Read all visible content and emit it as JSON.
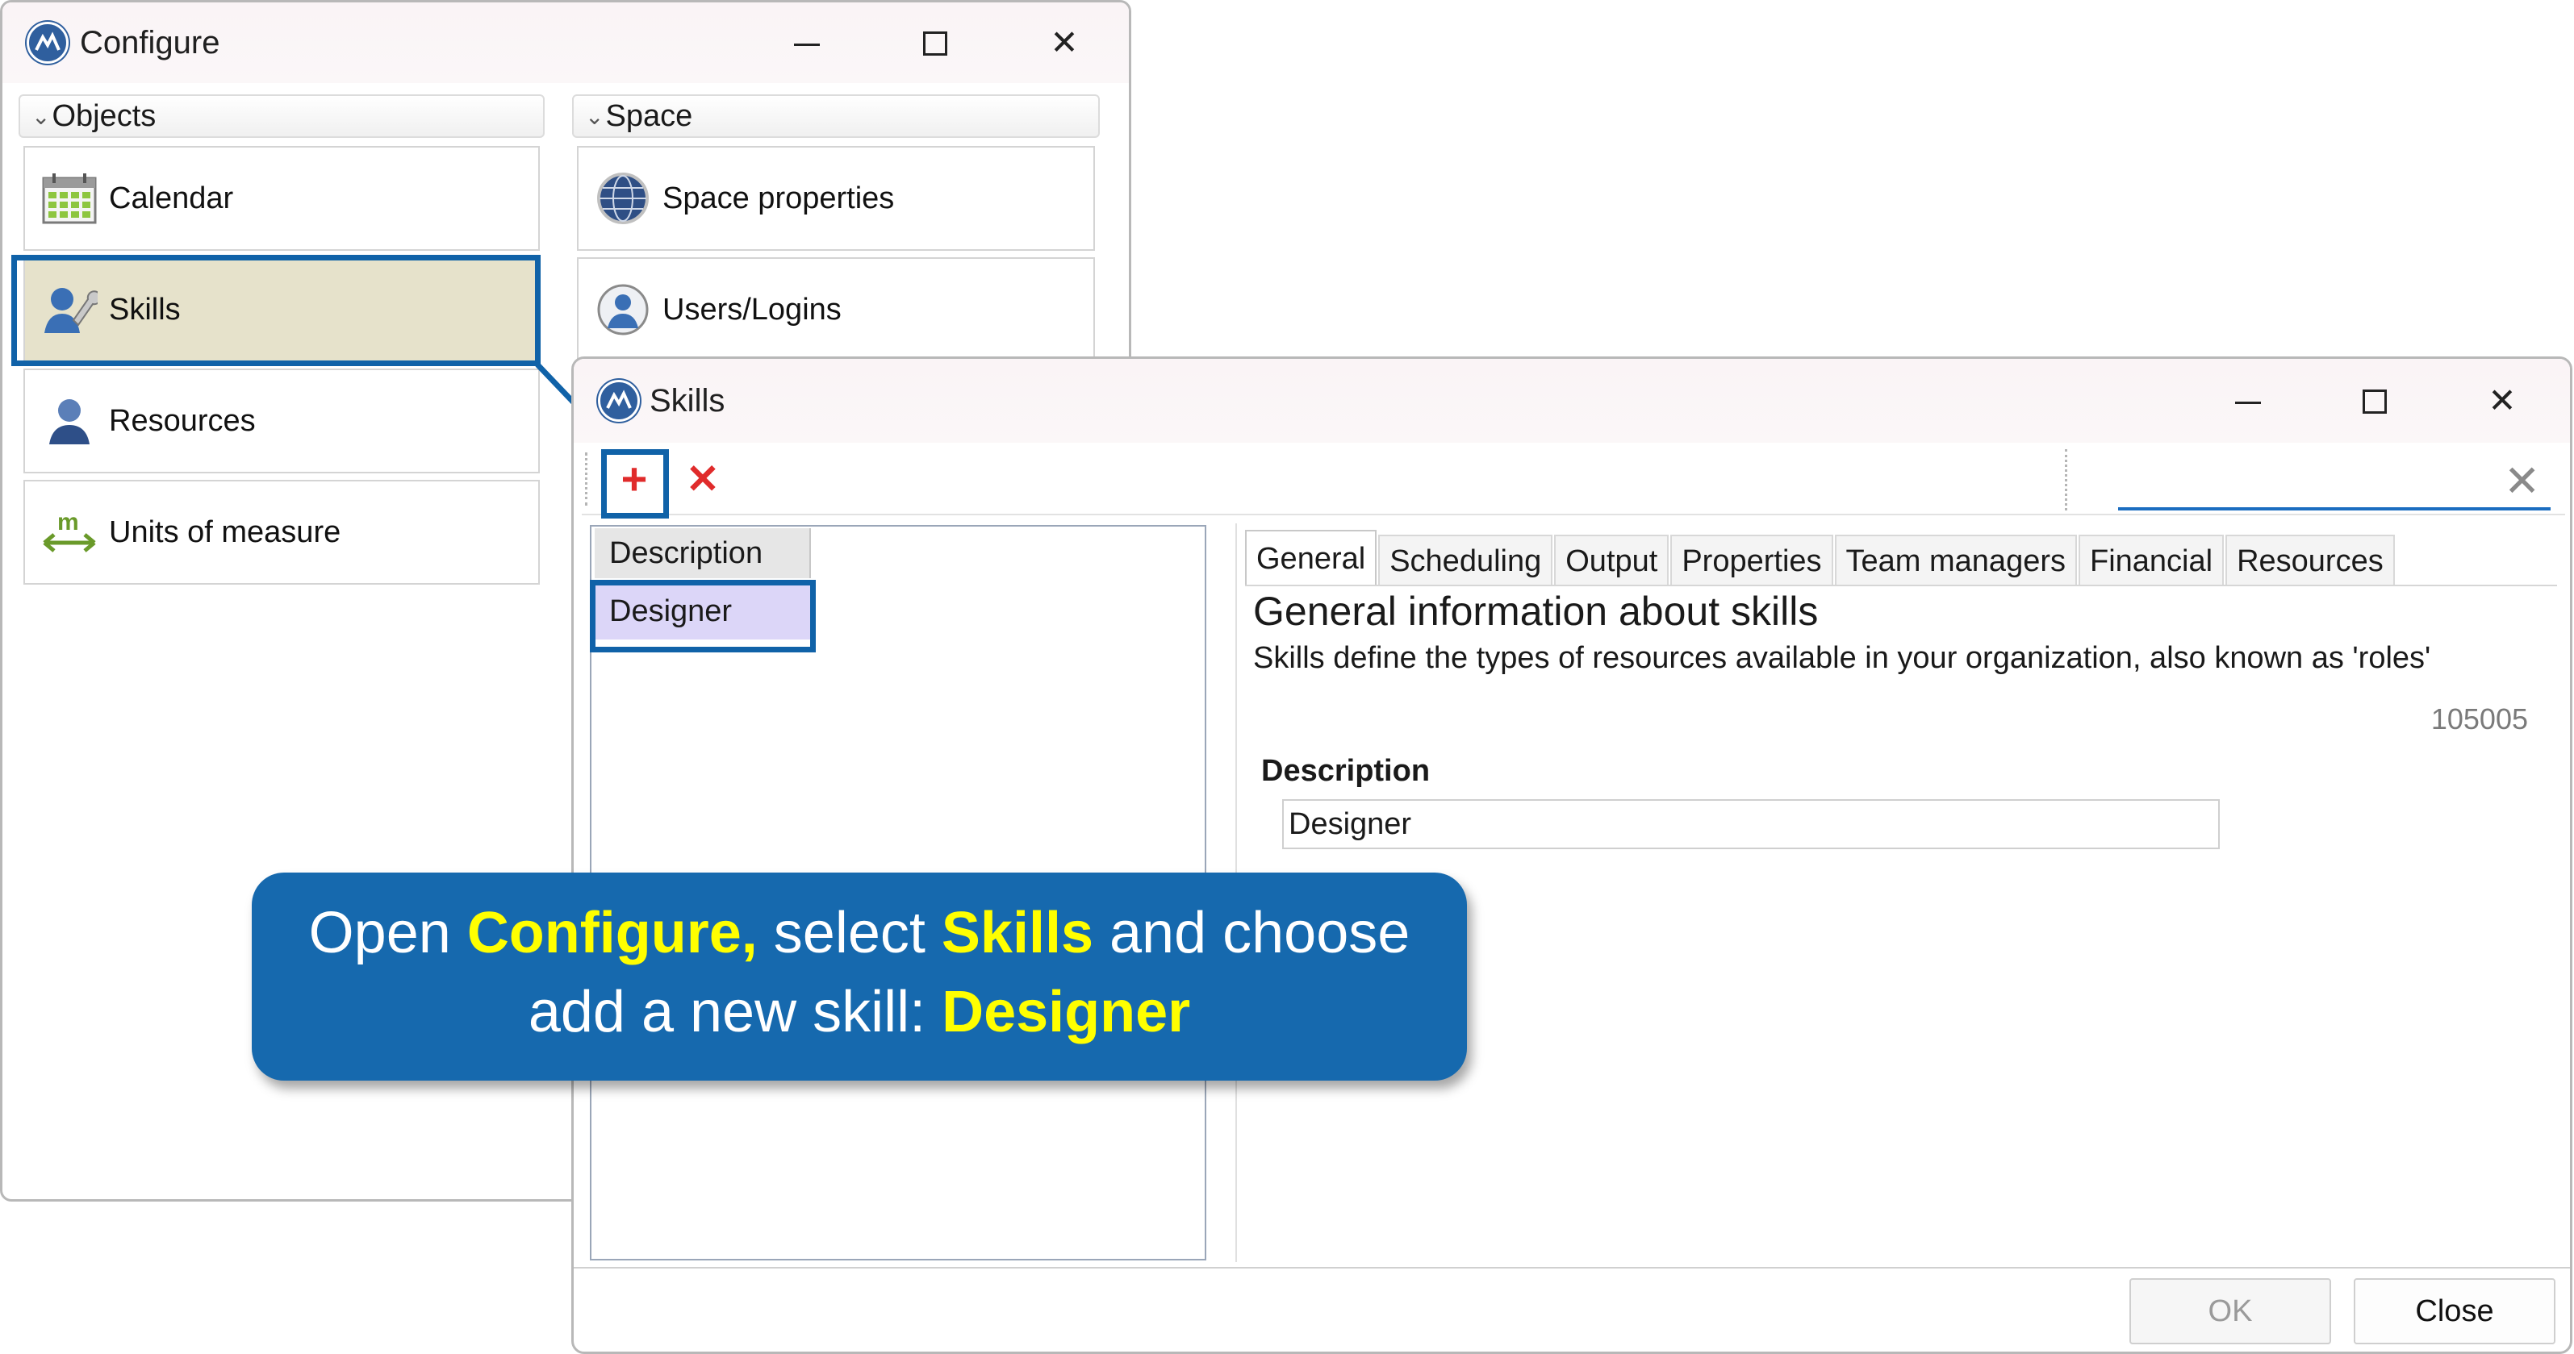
{
  "configure_window": {
    "title": "Configure",
    "groups": {
      "objects": {
        "header": "Objects",
        "items": [
          {
            "label": "Calendar",
            "icon": "calendar-icon"
          },
          {
            "label": "Skills",
            "icon": "skills-icon",
            "selected": true
          },
          {
            "label": "Resources",
            "icon": "resources-icon"
          },
          {
            "label": "Units of measure",
            "icon": "units-icon"
          }
        ]
      },
      "space": {
        "header": "Space",
        "items": [
          {
            "label": "Space properties",
            "icon": "globe-icon"
          },
          {
            "label": "Users/Logins",
            "icon": "user-icon"
          }
        ]
      }
    }
  },
  "skills_window": {
    "title": "Skills",
    "toolbar": {
      "add": "+",
      "delete": "✕"
    },
    "search": {
      "value": "",
      "clear_icon": "clear-icon"
    },
    "list": {
      "header": "Description",
      "rows": [
        "Designer"
      ]
    },
    "tabs": [
      "General",
      "Scheduling",
      "Output",
      "Properties",
      "Team managers",
      "Financial",
      "Resources"
    ],
    "active_tab": "General",
    "general": {
      "heading": "General information about skills",
      "subheading": "Skills define the types of resources available in your organization, also known as 'roles'",
      "id": "105005",
      "description_label": "Description",
      "description_value": "Designer"
    },
    "buttons": {
      "ok": "OK",
      "close": "Close"
    }
  },
  "callout": {
    "line1_a": "Open ",
    "line1_b": "Configure,",
    "line1_c": " select ",
    "line1_d": "Skills",
    "line1_e": " and choose",
    "line2_a": "add a new skill: ",
    "line2_b": "Designer"
  },
  "colors": {
    "accent_blue": "#1062a8",
    "callout_bg": "#1669ae",
    "callout_highlight": "#ffff00",
    "selected_tile": "#e6e2cb",
    "selected_row": "#dcd6f8",
    "add_red": "#e02b2b"
  }
}
